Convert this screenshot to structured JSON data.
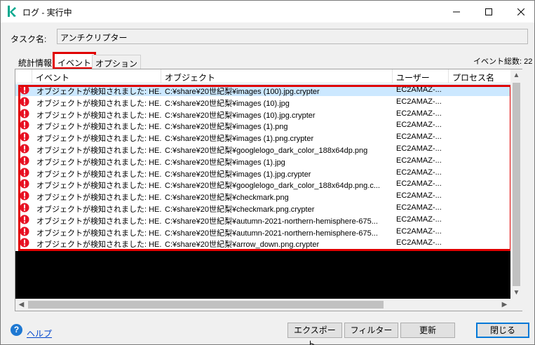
{
  "window": {
    "title": "ログ - 実行中",
    "minimize": "—",
    "maximize": "☐",
    "close": "✕"
  },
  "task": {
    "label": "タスク名:",
    "value": "アンチクリプター"
  },
  "tabs": [
    "統計情報",
    "イベント",
    "オプション"
  ],
  "event_total": "イベント総数: 22",
  "columns": [
    "イベント",
    "オブジェクト",
    "ユーザー",
    "プロセス名"
  ],
  "rows": [
    {
      "event": "オブジェクトが検知されました: HE...",
      "object": "C:¥share¥20世紀梨¥images (100).jpg.crypter",
      "user": "EC2AMAZ-..."
    },
    {
      "event": "オブジェクトが検知されました: HE...",
      "object": "C:¥share¥20世紀梨¥images (10).jpg",
      "user": "EC2AMAZ-..."
    },
    {
      "event": "オブジェクトが検知されました: HE...",
      "object": "C:¥share¥20世紀梨¥images (10).jpg.crypter",
      "user": "EC2AMAZ-..."
    },
    {
      "event": "オブジェクトが検知されました: HE...",
      "object": "C:¥share¥20世紀梨¥images (1).png",
      "user": "EC2AMAZ-..."
    },
    {
      "event": "オブジェクトが検知されました: HE...",
      "object": "C:¥share¥20世紀梨¥images (1).png.crypter",
      "user": "EC2AMAZ-..."
    },
    {
      "event": "オブジェクトが検知されました: HE...",
      "object": "C:¥share¥20世紀梨¥googlelogo_dark_color_188x64dp.png",
      "user": "EC2AMAZ-..."
    },
    {
      "event": "オブジェクトが検知されました: HE...",
      "object": "C:¥share¥20世紀梨¥images (1).jpg",
      "user": "EC2AMAZ-..."
    },
    {
      "event": "オブジェクトが検知されました: HE...",
      "object": "C:¥share¥20世紀梨¥images (1).jpg.crypter",
      "user": "EC2AMAZ-..."
    },
    {
      "event": "オブジェクトが検知されました: HE...",
      "object": "C:¥share¥20世紀梨¥googlelogo_dark_color_188x64dp.png.c...",
      "user": "EC2AMAZ-..."
    },
    {
      "event": "オブジェクトが検知されました: HE...",
      "object": "C:¥share¥20世紀梨¥checkmark.png",
      "user": "EC2AMAZ-..."
    },
    {
      "event": "オブジェクトが検知されました: HE...",
      "object": "C:¥share¥20世紀梨¥checkmark.png.crypter",
      "user": "EC2AMAZ-..."
    },
    {
      "event": "オブジェクトが検知されました: HE...",
      "object": "C:¥share¥20世紀梨¥autumn-2021-northern-hemisphere-675...",
      "user": "EC2AMAZ-..."
    },
    {
      "event": "オブジェクトが検知されました: HE...",
      "object": "C:¥share¥20世紀梨¥autumn-2021-northern-hemisphere-675...",
      "user": "EC2AMAZ-..."
    },
    {
      "event": "オブジェクトが検知されました: HE...",
      "object": "C:¥share¥20世紀梨¥arrow_down.png.crypter",
      "user": "EC2AMAZ-..."
    }
  ],
  "help": {
    "label": "ヘルプ"
  },
  "buttons": {
    "export": "エクスポート...",
    "filter": "フィルター",
    "refresh": "更新",
    "close": "閉じる"
  },
  "colors": {
    "highlight": "#e00000",
    "alert": "#e81123",
    "selected_row": "#cce8ff",
    "brand": "#00a88e"
  },
  "icons": {
    "app": "kaspersky-k-icon",
    "row": "alert-circle-icon",
    "help": "help-icon"
  }
}
